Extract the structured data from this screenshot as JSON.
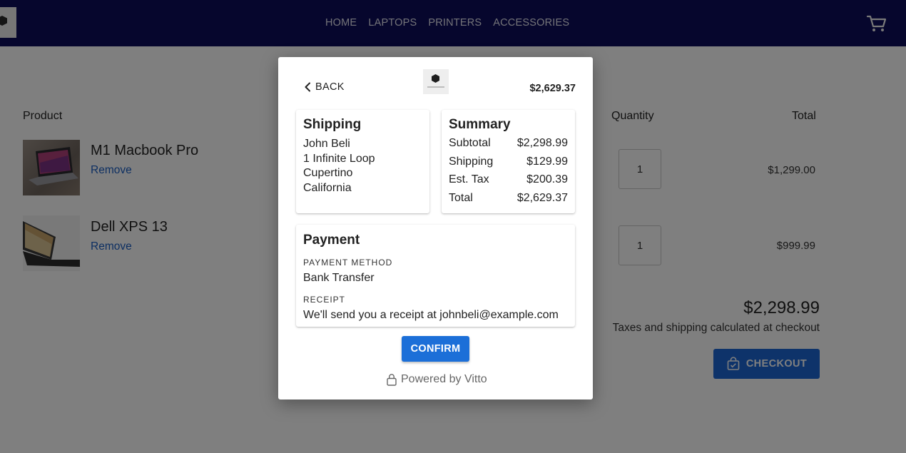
{
  "nav": {
    "links": [
      "HOME",
      "LAPTOPS",
      "PRINTERS",
      "ACCESSORIES"
    ],
    "cart_icon": "cart-icon",
    "logo_icon": "hexagon-logo"
  },
  "cart": {
    "headers": {
      "product": "Product",
      "quantity": "Quantity",
      "total": "Total"
    },
    "items": [
      {
        "name": "M1 Macbook Pro",
        "remove": "Remove",
        "quantity": "1",
        "total": "$1,299.00"
      },
      {
        "name": "Dell XPS 13",
        "remove": "Remove",
        "quantity": "1",
        "total": "$999.99"
      }
    ],
    "grand_total": "$2,298.99",
    "taxes_note": "Taxes and shipping calculated at checkout",
    "checkout_label": "CHECKOUT"
  },
  "modal": {
    "back_label": "BACK",
    "order_total": "$2,629.37",
    "shipping": {
      "title": "Shipping",
      "lines": [
        "John Beli",
        "1 Infinite Loop",
        "Cupertino",
        "California"
      ]
    },
    "summary": {
      "title": "Summary",
      "rows": [
        {
          "label": "Subtotal",
          "value": "$2,298.99"
        },
        {
          "label": "Shipping",
          "value": "$129.99"
        },
        {
          "label": "Est. Tax",
          "value": "$200.39"
        },
        {
          "label": "Total",
          "value": "$2,629.37"
        }
      ]
    },
    "payment": {
      "title": "Payment",
      "method_label": "PAYMENT METHOD",
      "method_value": "Bank Transfer",
      "receipt_label": "RECEIPT",
      "receipt_value": "We'll send you a receipt at johnbeli@example.com"
    },
    "confirm_label": "CONFIRM",
    "powered_by": "Powered by Vitto"
  },
  "colors": {
    "nav_bg": "#0c0c5a",
    "primary": "#1c6fd8",
    "link": "#1a5ec4"
  }
}
